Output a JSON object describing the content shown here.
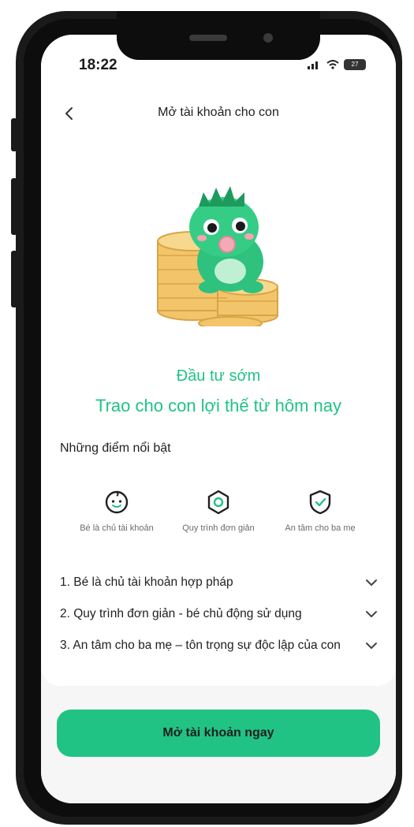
{
  "status": {
    "time": "18:22",
    "battery": "27"
  },
  "header": {
    "title": "Mở tài khoản cho con"
  },
  "hero": {
    "line1": "Đầu tư sớm",
    "line2": "Trao cho con lợi thế từ hôm nay"
  },
  "highlights": {
    "title": "Những điểm nổi bật",
    "features": [
      {
        "label": "Bé là chủ tài khoản",
        "icon": "baby-face-icon"
      },
      {
        "label": "Quy trình đơn giản",
        "icon": "hexagon-icon"
      },
      {
        "label": "An tâm cho ba mẹ",
        "icon": "shield-check-icon"
      }
    ]
  },
  "accordion": [
    "1. Bé là chủ tài khoản hợp pháp",
    "2. Quy trình đơn giản - bé chủ động sử dụng",
    "3. An tâm cho ba mẹ – tôn trọng sự độc lập của con"
  ],
  "cta": {
    "label": "Mở tài khoản ngay"
  },
  "colors": {
    "accent": "#21c384",
    "text": "#1f1f1f",
    "muted": "#6b6b6b"
  }
}
